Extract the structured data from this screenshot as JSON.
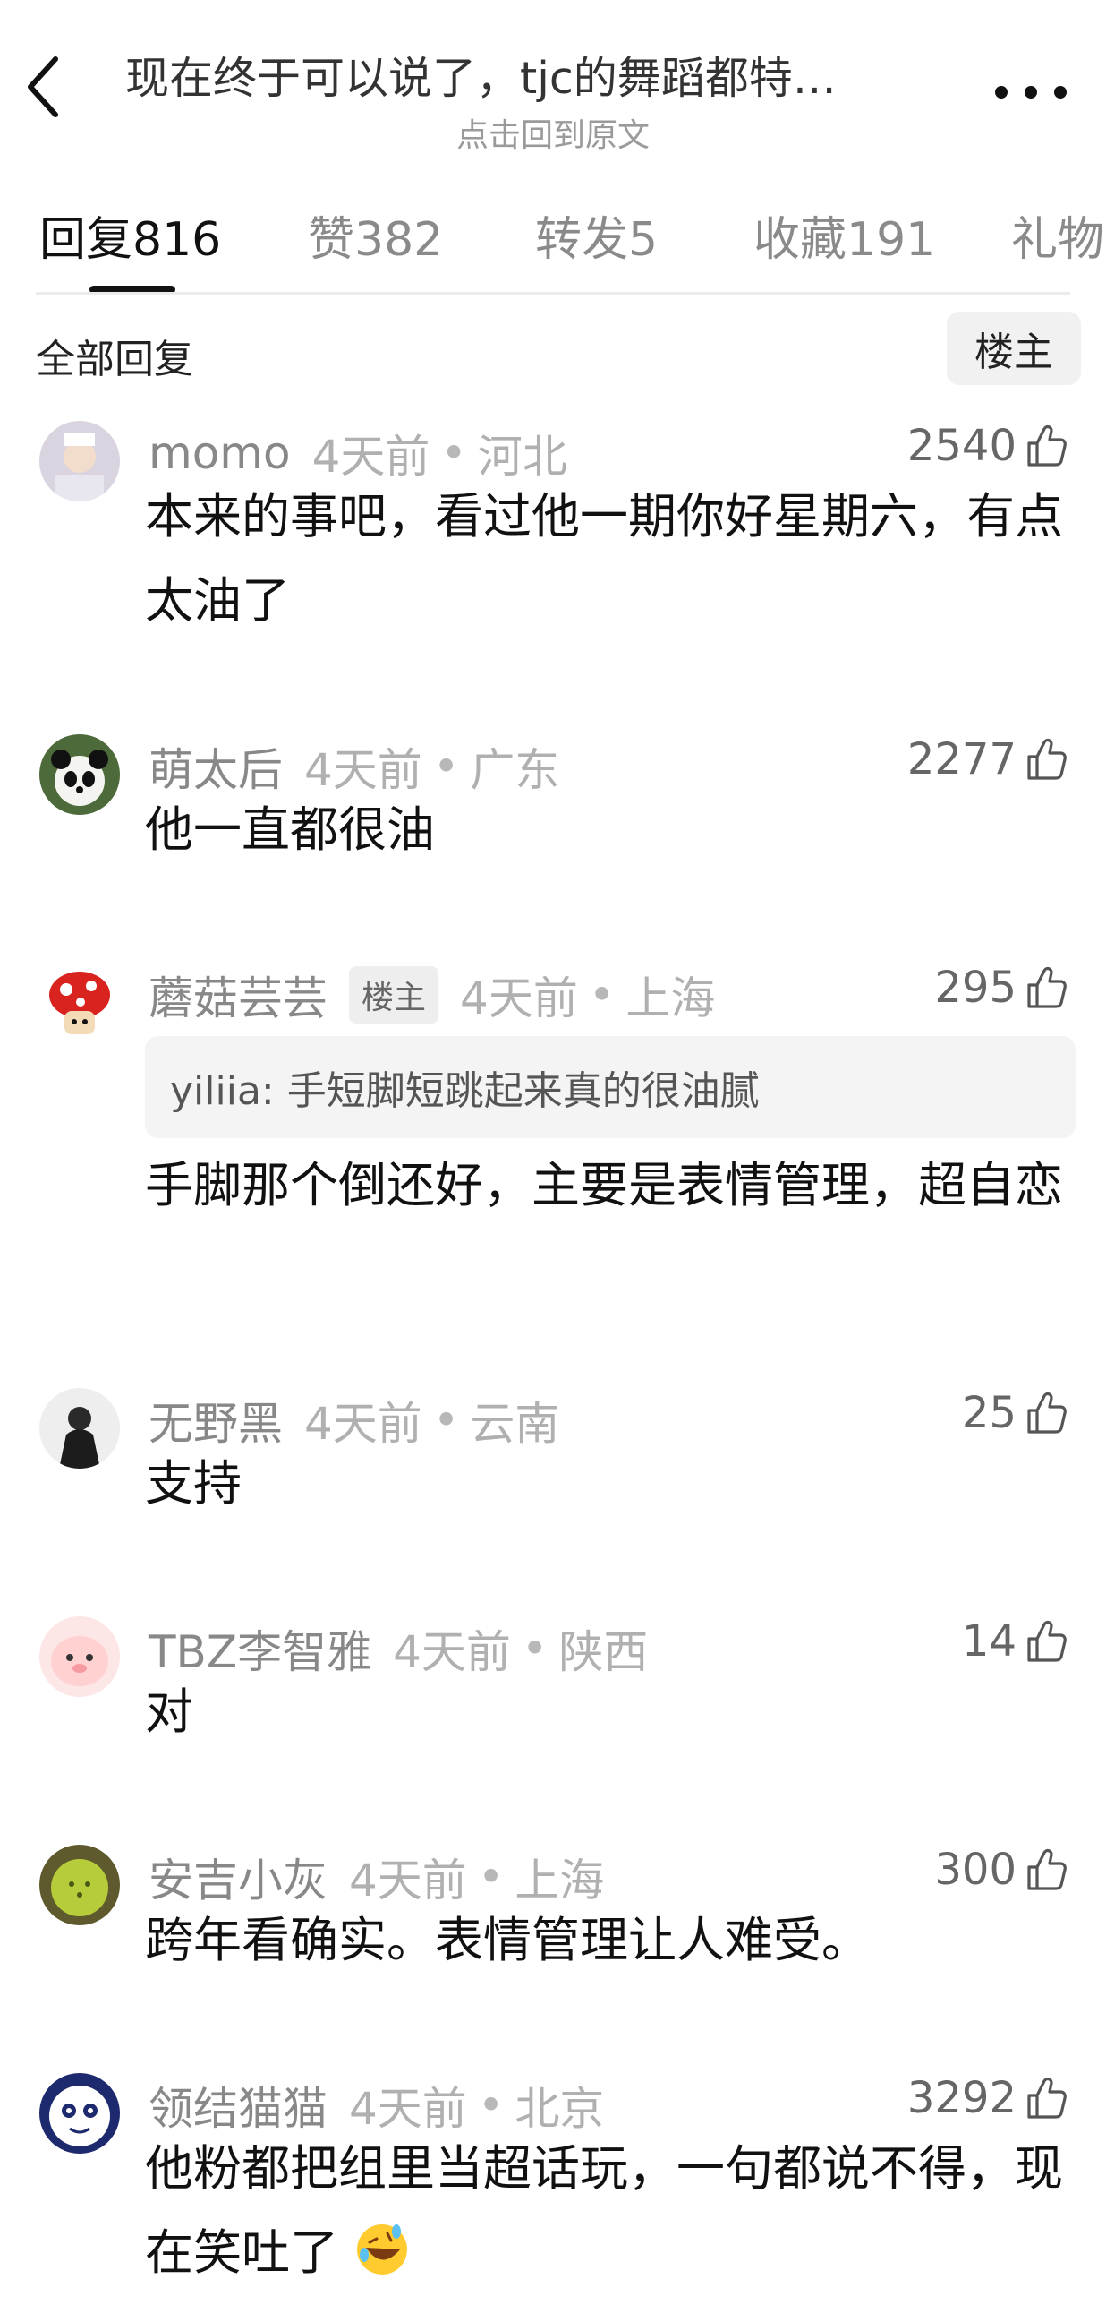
{
  "header": {
    "title": "现在终于可以说了，tjc的舞蹈都特…",
    "subtitle": "点击回到原文"
  },
  "tabs": [
    {
      "label": "回复",
      "count": "816"
    },
    {
      "label": "赞",
      "count": "382"
    },
    {
      "label": "转发",
      "count": "5"
    },
    {
      "label": "收藏",
      "count": "191"
    },
    {
      "label": "礼物",
      "count": ""
    }
  ],
  "section": {
    "all_replies": "全部回复",
    "owner_filter": "楼主"
  },
  "comments": [
    {
      "name": "momo",
      "time": "4天前",
      "region": "河北",
      "likes": "2540",
      "text": "本来的事吧，看过他一期你好星期六，有点太油了"
    },
    {
      "name": "萌太后",
      "time": "4天前",
      "region": "广东",
      "likes": "2277",
      "text": "他一直都很油"
    },
    {
      "name": "蘑菇芸芸",
      "badge": "楼主",
      "time": "4天前",
      "region": "上海",
      "likes": "295",
      "quote": "yiliia: 手短脚短跳起来真的很油腻",
      "text": "手脚那个倒还好，主要是表情管理，超自恋"
    },
    {
      "name": "无野黑",
      "time": "4天前",
      "region": "云南",
      "likes": "25",
      "text": "支持"
    },
    {
      "name": "TBZ李智雅",
      "time": "4天前",
      "region": "陕西",
      "likes": "14",
      "text": "对"
    },
    {
      "name": "安吉小灰",
      "time": "4天前",
      "region": "上海",
      "likes": "300",
      "text": "跨年看确实。表情管理让人难受。"
    },
    {
      "name": "领结猫猫",
      "time": "4天前",
      "region": "北京",
      "likes": "3292",
      "text": "他粉都把组里当超话玩，一句都说不得，现在笑吐了"
    }
  ],
  "icons": {
    "back": "chevron-left-icon",
    "more": "more-dots-icon",
    "like": "thumbs-up-icon",
    "emoji": "rolling-laughing-emoji"
  },
  "colors": {
    "text_primary": "#111111",
    "text_secondary": "#8a8a8a",
    "divider": "#ececec"
  }
}
